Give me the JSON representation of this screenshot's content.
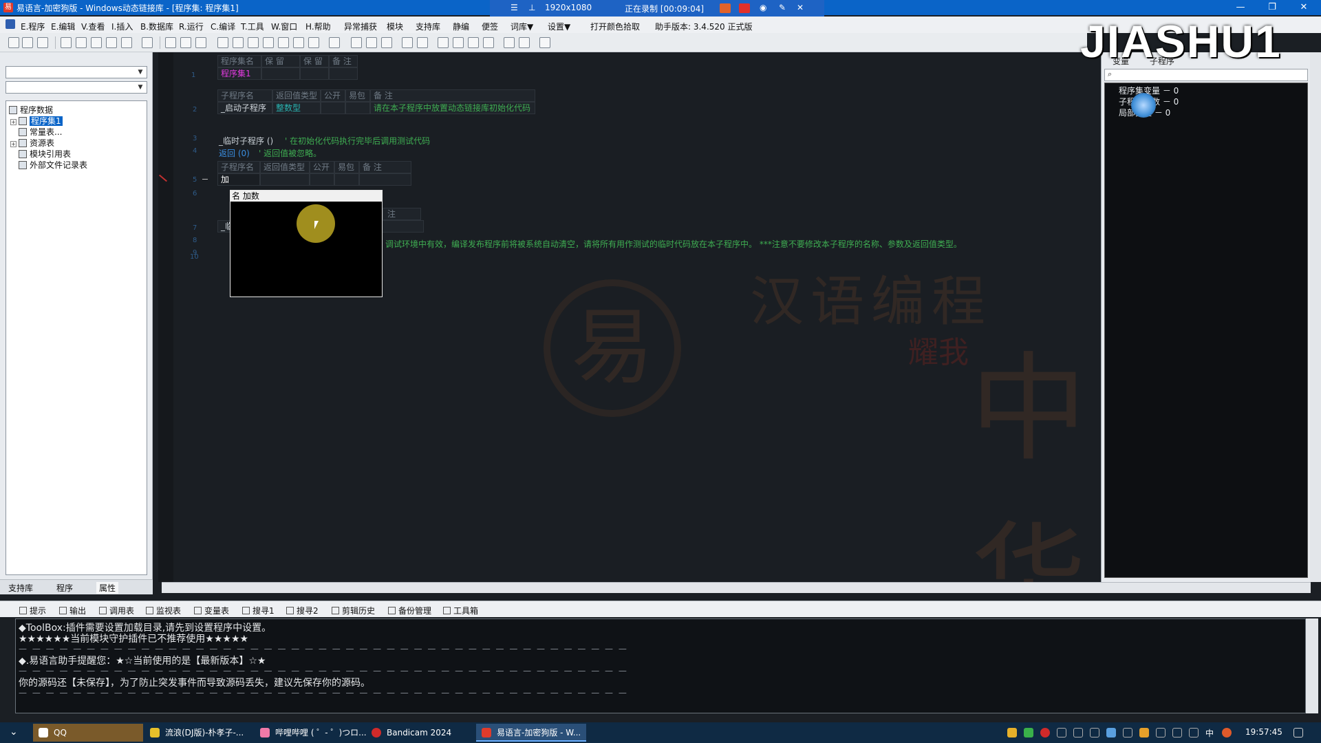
{
  "window": {
    "title": "易语言-加密狗版 - Windows动态链接库 - [程序集: 程序集1]",
    "app_icon_label": "易",
    "minimize": "—",
    "restore": "❐",
    "close": "✕"
  },
  "recorder": {
    "resolution": "1920x1080",
    "status": "正在录制 [00:09:04]"
  },
  "menu": {
    "items": [
      "E.程序",
      "E.编辑",
      "V.查看",
      "I.插入",
      "B.数据库",
      "R.运行",
      "C.编译",
      "T.工具",
      "W.窗口",
      "H.帮助",
      "异常捕获",
      "模块",
      "支持库",
      "静编",
      "便签",
      "词库▼",
      "设置▼",
      "打开颜色拾取",
      "助手版本: 3.4.520 正式版"
    ]
  },
  "left": {
    "tree": {
      "root": "程序数据",
      "items": [
        "程序集1",
        "常量表...",
        "资源表",
        "模块引用表",
        "外部文件记录表"
      ]
    },
    "tabs": [
      "支持库",
      "程序",
      "属性"
    ]
  },
  "editor": {
    "line_numbers": [
      "1",
      "2",
      "3",
      "4",
      "5",
      "6",
      "7",
      "8",
      "9",
      "10"
    ],
    "asm_header": [
      "程序集名",
      "保 留",
      "保 留",
      "备 注"
    ],
    "asm_name": "程序集1",
    "sub_header": [
      "子程序名",
      "返回值类型",
      "公开",
      "易包",
      "备 注"
    ],
    "sub1_name": "_启动子程序",
    "sub1_type": "整数型",
    "sub1_note": "请在本子程序中放置动态链接库初始化代码",
    "line_temp_call": "_临时子程序 ()",
    "line_temp_comment": "' 在初始化代码执行完毕后调用测试代码",
    "line_return": "返回 (0)",
    "line_return_comment": "' 返回值被忽略。",
    "sub2_header": [
      "子程序名",
      "返回值类型",
      "公开",
      "易包",
      "备 注"
    ],
    "sub2_name": "加",
    "sub3_header_tail": "注",
    "sub3_name_prefix": "_临",
    "long_comment": "调试环境中有效，编译发布程序前将被系统自动清空，请将所有用作测试的临时代码放在本子程序中。 ***注意不要修改本子程序的名称、参数及返回值类型。",
    "watermark": [
      "汉语编程",
      "耀我",
      "中华",
      "易"
    ]
  },
  "autocomplete": {
    "header": "名 加数"
  },
  "right": {
    "tabs": [
      "变量",
      "子程序"
    ],
    "nodes": [
      "程序集变量 － 0",
      "子程序参数 － 0",
      "局部变量 － 0"
    ],
    "logo": "JIASHU1"
  },
  "bottom_tabs": [
    "提示",
    "输出",
    "调用表",
    "监视表",
    "变量表",
    "搜寻1",
    "搜寻2",
    "剪辑历史",
    "备份管理",
    "工具箱"
  ],
  "output": {
    "lines": [
      "◆ToolBox:插件需要设置加载目录,请先到设置程序中设置。",
      "★★★★★★当前模块守护插件已不推荐使用★★★★★",
      "◆.易语言助手提醒您：★☆当前使用的是【最新版本】☆★",
      "你的源码还【未保存】，为了防止突发事件而导致源码丢失，建议先保存你的源码。"
    ],
    "dashes": "— — — — — — — — — — — — — — — — — — — — — — — — — — — — — — — — — — — — — — — — — — — — —"
  },
  "taskbar": {
    "tasks": [
      "QQ",
      "流浪(DJ版)-朴孝子-...",
      "哔哩哔哩 ( ゜- ゜)つロ...",
      "Bandicam 2024",
      "易语言-加密狗版 - W..."
    ],
    "ime": "中",
    "time": "19:57:45"
  },
  "colors": {
    "titlebar": "#0a64c8",
    "editor_bg": "#1a1e23",
    "magenta": "#e33be0",
    "teal": "#2ab3b0",
    "comment_green": "#3fae52"
  }
}
